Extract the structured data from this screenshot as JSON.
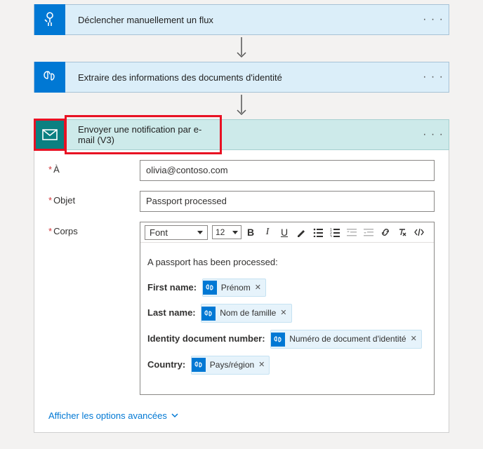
{
  "steps": {
    "trigger": {
      "title": "Déclencher manuellement un flux"
    },
    "extract": {
      "title": "Extraire des informations des documents d'identité"
    },
    "email": {
      "title": "Envoyer une notification par e-mail (V3)"
    }
  },
  "labels": {
    "to": "À",
    "subject": "Objet",
    "body": "Corps",
    "advanced": "Afficher les options avancées"
  },
  "form": {
    "to": "olivia@contoso.com",
    "subject": "Passport processed"
  },
  "toolbar": {
    "font": "Font",
    "size": "12"
  },
  "body": {
    "intro": "A passport has been processed:",
    "firstname_label": "First name:",
    "lastname_label": "Last name:",
    "docnum_label": "Identity document number:",
    "country_label": "Country:"
  },
  "tokens": {
    "firstname": "Prénom",
    "lastname": "Nom de famille",
    "docnum": "Numéro de document d'identité",
    "country": "Pays/région"
  }
}
